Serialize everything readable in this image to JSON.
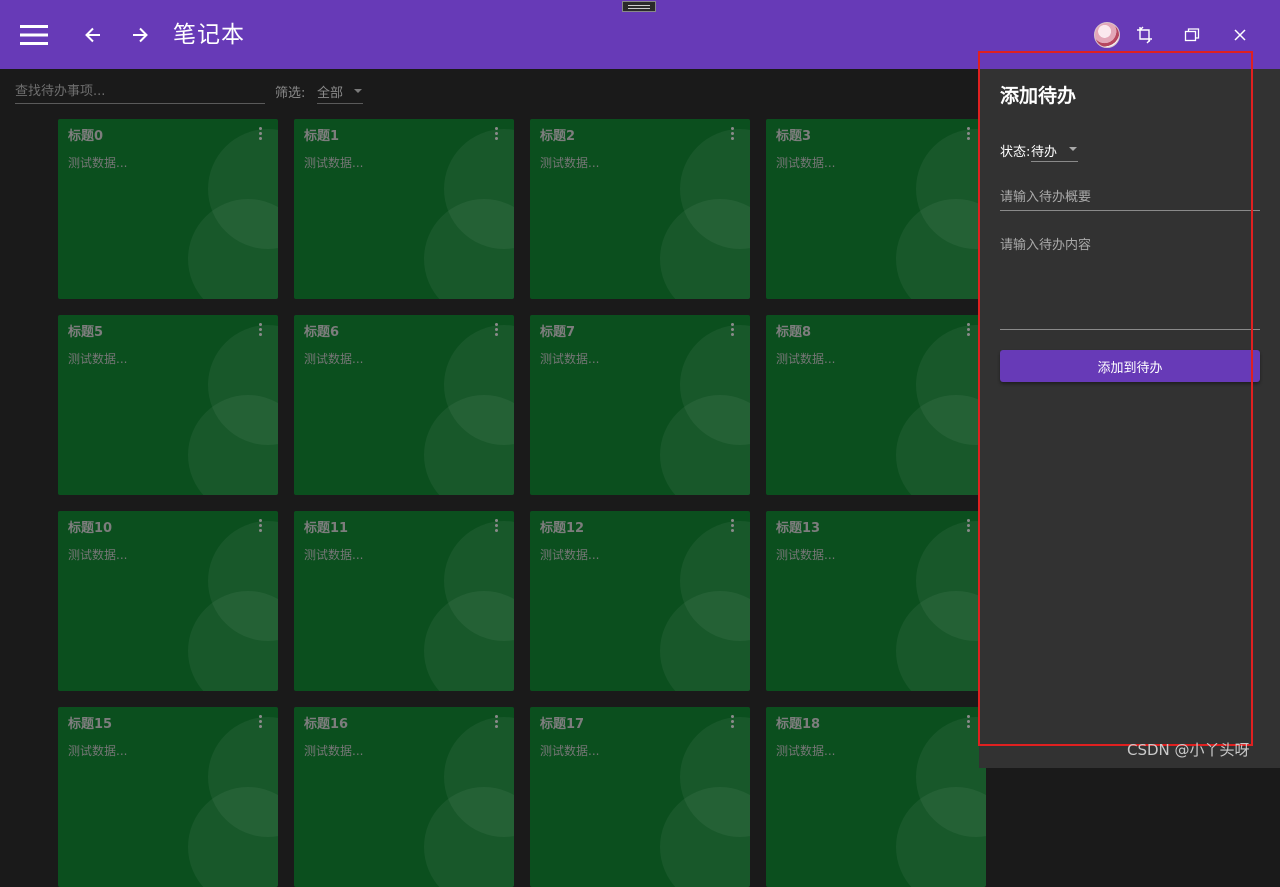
{
  "appbar": {
    "title": "笔记本",
    "icons": [
      "menu-icon",
      "arrow-left-icon",
      "arrow-right-icon",
      "avatar",
      "theme-toggle-icon",
      "maximize-icon",
      "close-icon"
    ]
  },
  "filter": {
    "search_placeholder": "查找待办事项...",
    "label": "筛选:",
    "selected": "全部"
  },
  "cards": [
    {
      "title": "标题0",
      "body": "测试数据..."
    },
    {
      "title": "标题1",
      "body": "测试数据..."
    },
    {
      "title": "标题2",
      "body": "测试数据..."
    },
    {
      "title": "标题3",
      "body": "测试数据..."
    },
    {
      "title": "标题5",
      "body": "测试数据..."
    },
    {
      "title": "标题6",
      "body": "测试数据..."
    },
    {
      "title": "标题7",
      "body": "测试数据..."
    },
    {
      "title": "标题8",
      "body": "测试数据..."
    },
    {
      "title": "标题10",
      "body": "测试数据..."
    },
    {
      "title": "标题11",
      "body": "测试数据..."
    },
    {
      "title": "标题12",
      "body": "测试数据..."
    },
    {
      "title": "标题13",
      "body": "测试数据..."
    },
    {
      "title": "标题15",
      "body": "测试数据..."
    },
    {
      "title": "标题16",
      "body": "测试数据..."
    },
    {
      "title": "标题17",
      "body": "测试数据..."
    },
    {
      "title": "标题18",
      "body": "测试数据..."
    }
  ],
  "drawer": {
    "title": "添加待办",
    "status_label": "状态:",
    "status_value": "待办",
    "summary_placeholder": "请输入待办概要",
    "content_placeholder": "请输入待办内容",
    "add_button": "添加到待办"
  },
  "colors": {
    "appbar": "#673ab7",
    "card": "#0b4f1e",
    "drawer": "#323232",
    "background": "#1a1a1a",
    "highlight": "#e02020"
  },
  "watermark": "CSDN @小丫头呀"
}
